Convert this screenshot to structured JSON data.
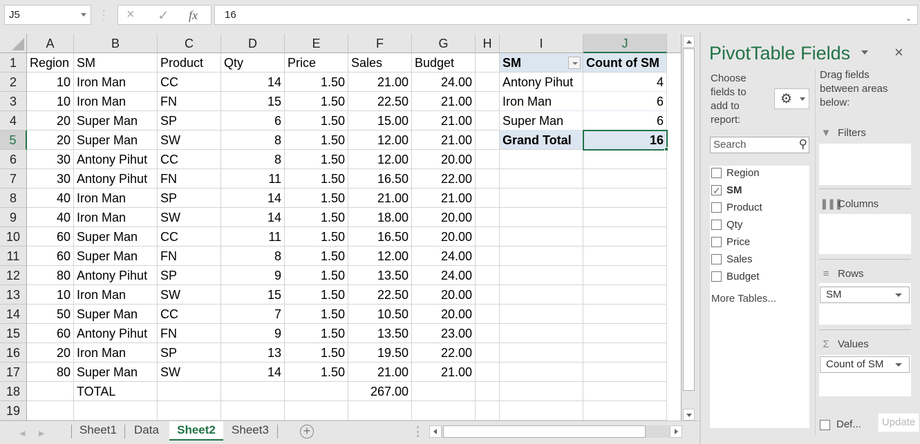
{
  "formula_bar": {
    "name_box": "J5",
    "formula": "16",
    "cancel_icon": "×",
    "enter_icon": "✓",
    "fx_label": "fx"
  },
  "columns": [
    "A",
    "B",
    "C",
    "D",
    "E",
    "F",
    "G",
    "H",
    "I",
    "J"
  ],
  "selected_cell": "J5",
  "rows": [
    {
      "n": "1",
      "A": "Region",
      "B": "SM",
      "C": "Product",
      "D": "Qty",
      "E": "Price",
      "F": "Sales",
      "G": "Budget"
    },
    {
      "n": "2",
      "A": "10",
      "B": "Iron Man",
      "C": "CC",
      "D": "14",
      "E": "1.50",
      "F": "21.00",
      "G": "24.00"
    },
    {
      "n": "3",
      "A": "10",
      "B": "Iron Man",
      "C": "FN",
      "D": "15",
      "E": "1.50",
      "F": "22.50",
      "G": "21.00"
    },
    {
      "n": "4",
      "A": "20",
      "B": "Super Man",
      "C": "SP",
      "D": "6",
      "E": "1.50",
      "F": "15.00",
      "G": "21.00"
    },
    {
      "n": "5",
      "A": "20",
      "B": "Super Man",
      "C": "SW",
      "D": "8",
      "E": "1.50",
      "F": "12.00",
      "G": "21.00"
    },
    {
      "n": "6",
      "A": "30",
      "B": "Antony Pihut",
      "C": "CC",
      "D": "8",
      "E": "1.50",
      "F": "12.00",
      "G": "20.00"
    },
    {
      "n": "7",
      "A": "30",
      "B": "Antony Pihut",
      "C": "FN",
      "D": "11",
      "E": "1.50",
      "F": "16.50",
      "G": "22.00"
    },
    {
      "n": "8",
      "A": "40",
      "B": "Iron Man",
      "C": "SP",
      "D": "14",
      "E": "1.50",
      "F": "21.00",
      "G": "21.00"
    },
    {
      "n": "9",
      "A": "40",
      "B": "Iron Man",
      "C": "SW",
      "D": "14",
      "E": "1.50",
      "F": "18.00",
      "G": "20.00"
    },
    {
      "n": "10",
      "A": "60",
      "B": "Super Man",
      "C": "CC",
      "D": "11",
      "E": "1.50",
      "F": "16.50",
      "G": "20.00"
    },
    {
      "n": "11",
      "A": "60",
      "B": "Super Man",
      "C": "FN",
      "D": "8",
      "E": "1.50",
      "F": "12.00",
      "G": "24.00"
    },
    {
      "n": "12",
      "A": "80",
      "B": "Antony Pihut",
      "C": "SP",
      "D": "9",
      "E": "1.50",
      "F": "13.50",
      "G": "24.00"
    },
    {
      "n": "13",
      "A": "10",
      "B": "Iron Man",
      "C": "SW",
      "D": "15",
      "E": "1.50",
      "F": "22.50",
      "G": "20.00"
    },
    {
      "n": "14",
      "A": "50",
      "B": "Super Man",
      "C": "CC",
      "D": "7",
      "E": "1.50",
      "F": "10.50",
      "G": "20.00"
    },
    {
      "n": "15",
      "A": "60",
      "B": "Antony Pihut",
      "C": "FN",
      "D": "9",
      "E": "1.50",
      "F": "13.50",
      "G": "23.00"
    },
    {
      "n": "16",
      "A": "20",
      "B": "Iron Man",
      "C": "SP",
      "D": "13",
      "E": "1.50",
      "F": "19.50",
      "G": "22.00"
    },
    {
      "n": "17",
      "A": "80",
      "B": "Super Man",
      "C": "SW",
      "D": "14",
      "E": "1.50",
      "F": "21.00",
      "G": "21.00"
    },
    {
      "n": "18",
      "A": "",
      "B": "TOTAL",
      "C": "",
      "D": "",
      "E": "",
      "F": "267.00",
      "G": ""
    },
    {
      "n": "19",
      "A": "",
      "B": "",
      "C": "",
      "D": "",
      "E": "",
      "F": "",
      "G": ""
    }
  ],
  "pivot_table": {
    "header_row_label": "SM",
    "header_value_label": "Count of SM",
    "rows": [
      {
        "label": "Antony Pihut",
        "value": "4"
      },
      {
        "label": "Iron Man",
        "value": "6"
      },
      {
        "label": "Super Man",
        "value": "6"
      }
    ],
    "grand_total_label": "Grand Total",
    "grand_total_value": "16"
  },
  "sheet_tabs": [
    {
      "label": "Sheet1",
      "active": false
    },
    {
      "label": "Data",
      "active": false
    },
    {
      "label": "Sheet2",
      "active": true
    },
    {
      "label": "Sheet3",
      "active": false
    }
  ],
  "add_sheet_icon": "+",
  "pivot_panel": {
    "title": "PivotTable Fields",
    "close_icon": "×",
    "choose_text": "Choose fields to add to report:",
    "gear_icon": "⚙",
    "drag_text": "Drag fields between areas below:",
    "search_placeholder": "Search",
    "search_icon": "⚲",
    "fields": [
      {
        "label": "Region",
        "checked": false
      },
      {
        "label": "SM",
        "checked": true
      },
      {
        "label": "Product",
        "checked": false
      },
      {
        "label": "Qty",
        "checked": false
      },
      {
        "label": "Price",
        "checked": false
      },
      {
        "label": "Sales",
        "checked": false
      },
      {
        "label": "Budget",
        "checked": false
      }
    ],
    "more_tables": "More Tables...",
    "areas": {
      "filters": {
        "label": "Filters",
        "icon": "▼",
        "items": []
      },
      "columns": {
        "label": "Columns",
        "icon": "|||",
        "items": []
      },
      "rows": {
        "label": "Rows",
        "icon": "≡",
        "items": [
          "SM"
        ]
      },
      "values": {
        "label": "Values",
        "icon": "Σ",
        "items": [
          "Count of SM"
        ]
      }
    },
    "defer_label": "Def...",
    "defer_checked": false,
    "update_label": "Update"
  },
  "colors": {
    "accent": "#217346",
    "pivot_header_bg": "#dce6f1",
    "grid_line": "#d4d4d4"
  }
}
